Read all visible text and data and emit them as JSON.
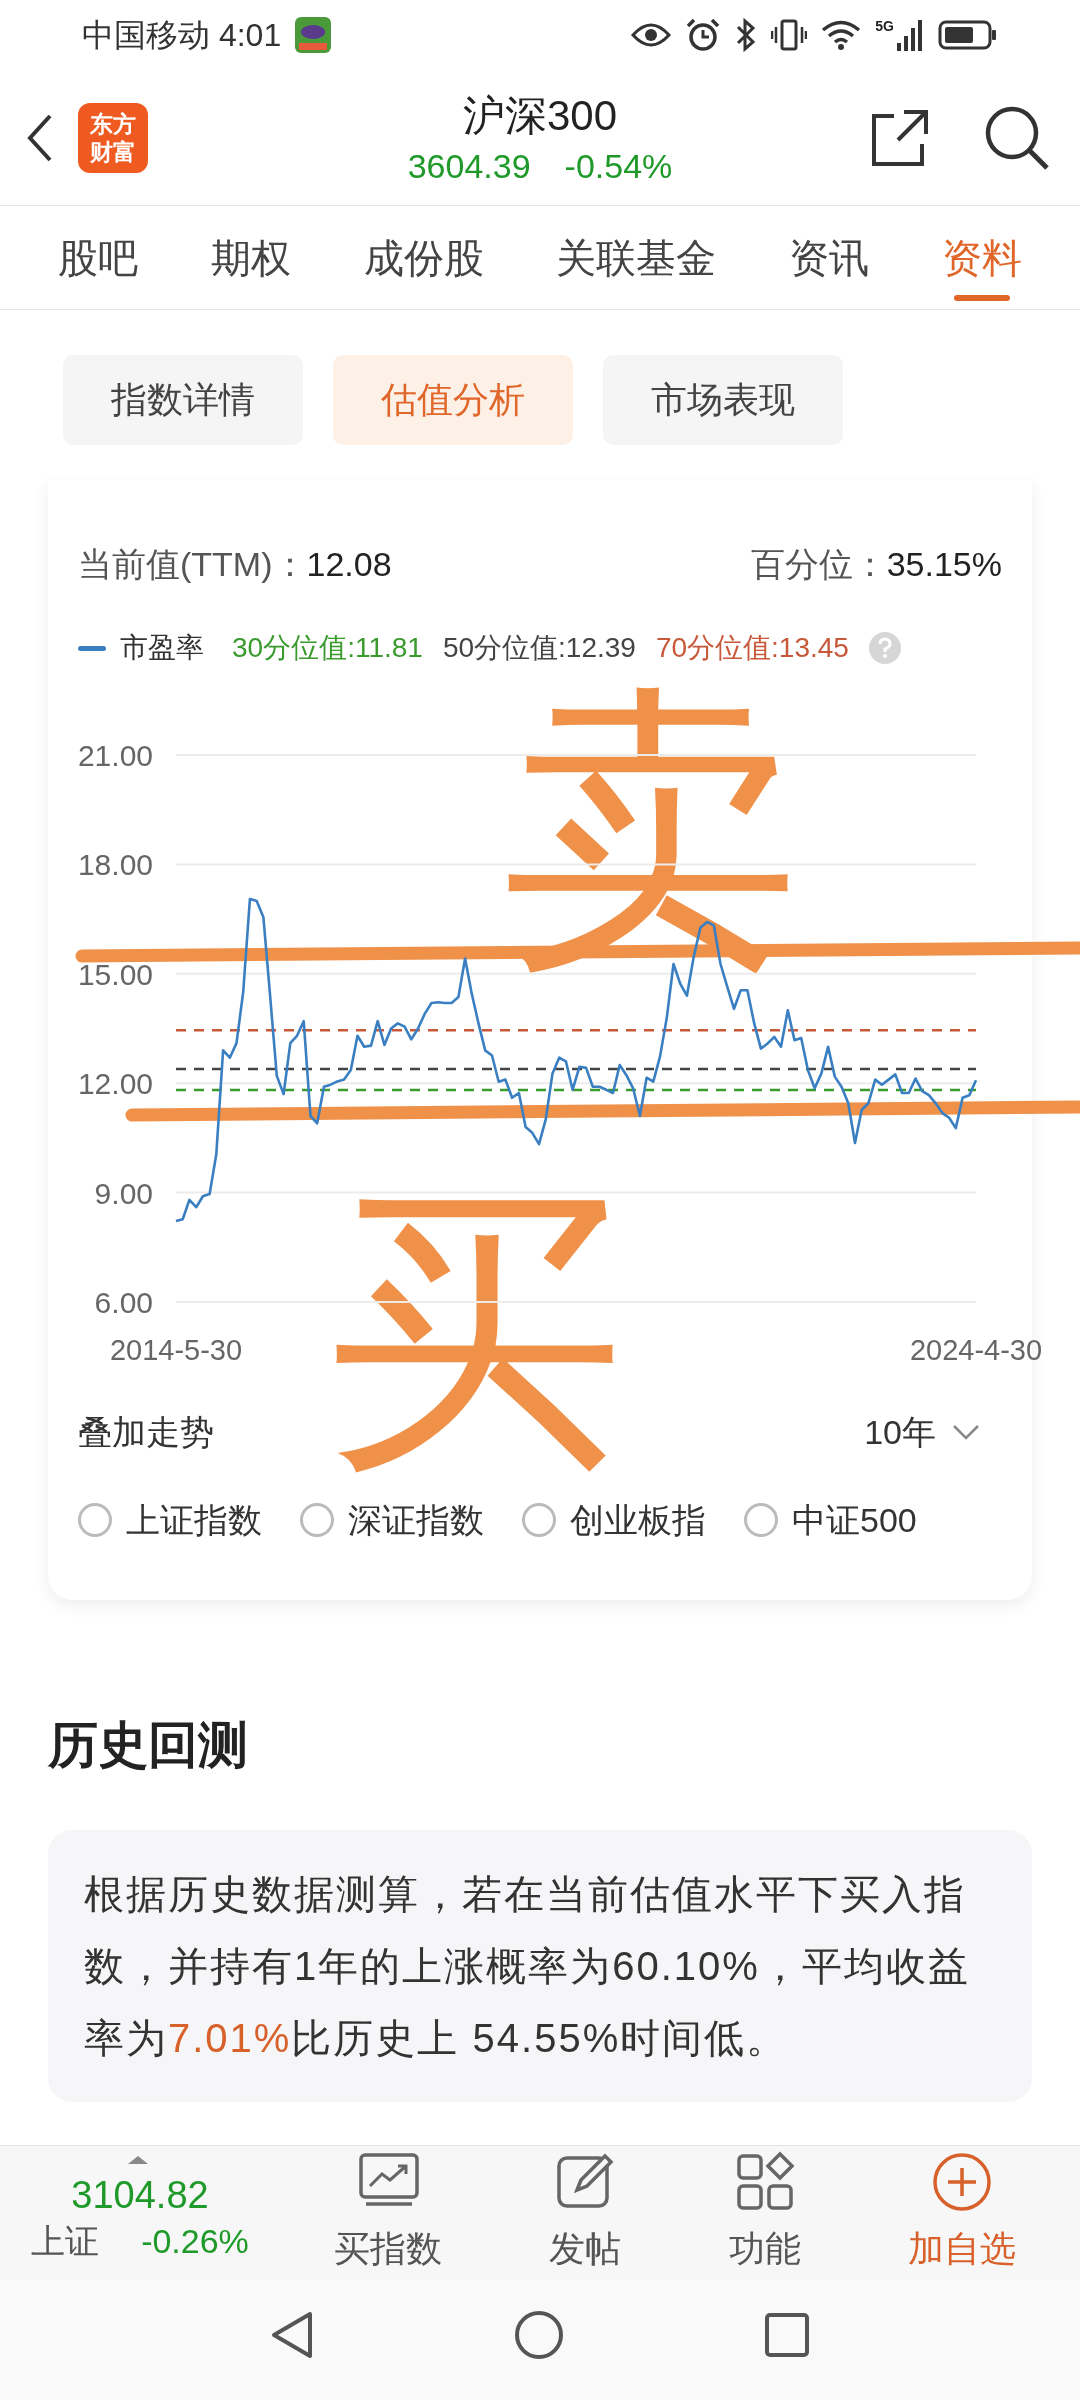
{
  "status_bar": {
    "carrier_time": "中国移动 4:01",
    "network": "5G"
  },
  "header": {
    "logo": [
      "东方",
      "财富"
    ],
    "title": "沪深300",
    "price": "3604.39",
    "change": "-0.54%"
  },
  "tabs": [
    {
      "label": "股吧",
      "selected": false
    },
    {
      "label": "期权",
      "selected": false
    },
    {
      "label": "成份股",
      "selected": false
    },
    {
      "label": "关联基金",
      "selected": false
    },
    {
      "label": "资讯",
      "selected": false
    },
    {
      "label": "资料",
      "selected": true
    }
  ],
  "sub_tabs": [
    {
      "label": "指数详情",
      "selected": false
    },
    {
      "label": "估值分析",
      "selected": true
    },
    {
      "label": "市场表现",
      "selected": false
    }
  ],
  "valuation": {
    "current_label": "当前值(TTM)：",
    "current_value": "12.08",
    "percentile_label": "百分位：",
    "percentile_value": "35.15%",
    "chart_data": {
      "type": "line",
      "ylim": [
        6,
        21
      ],
      "yticks": [
        {
          "value": 6,
          "label": "6.00"
        },
        {
          "value": 9,
          "label": "9.00"
        },
        {
          "value": 12,
          "label": "12.00"
        },
        {
          "value": 15,
          "label": "15.00"
        },
        {
          "value": 18,
          "label": "18.00"
        },
        {
          "value": 21,
          "label": "21.00"
        }
      ],
      "categories": [
        "2014-5-30",
        null,
        null,
        null,
        null,
        null,
        null,
        null,
        null,
        null,
        null,
        null,
        null,
        null,
        null,
        null,
        null,
        null,
        null,
        null,
        null,
        null,
        null,
        null,
        null,
        null,
        null,
        null,
        null,
        null,
        null,
        null,
        null,
        null,
        null,
        null,
        null,
        null,
        null,
        null,
        null,
        null,
        null,
        null,
        null,
        null,
        null,
        null,
        null,
        null,
        null,
        null,
        null,
        null,
        null,
        null,
        null,
        null,
        null,
        null,
        null,
        null,
        null,
        null,
        null,
        null,
        null,
        null,
        null,
        null,
        null,
        null,
        null,
        null,
        null,
        null,
        null,
        null,
        null,
        null,
        null,
        null,
        null,
        null,
        null,
        null,
        null,
        null,
        null,
        null,
        null,
        null,
        null,
        null,
        null,
        null,
        null,
        null,
        null,
        null,
        null,
        null,
        null,
        null,
        null,
        null,
        null,
        null,
        null,
        null,
        null,
        null,
        null,
        null,
        null,
        null,
        null,
        null,
        null,
        "2024-4-30"
      ],
      "series": [
        {
          "name": "市盈率",
          "color": "#3a7fc1",
          "line_style": "solid",
          "values": [
            8.22,
            8.27,
            8.8,
            8.6,
            8.9,
            8.96,
            10.05,
            12.9,
            12.7,
            13.1,
            14.5,
            17.05,
            17.0,
            16.55,
            14.4,
            12.2,
            11.7,
            13.1,
            13.3,
            13.7,
            11.1,
            10.9,
            11.9,
            11.96,
            12.05,
            12.1,
            12.36,
            13.3,
            13.0,
            13.03,
            13.7,
            13.05,
            13.5,
            13.64,
            13.55,
            13.2,
            13.5,
            13.9,
            14.2,
            14.22,
            14.2,
            14.2,
            14.36,
            15.42,
            14.45,
            13.64,
            12.9,
            12.76,
            12.04,
            12.1,
            11.6,
            11.73,
            10.8,
            10.64,
            10.33,
            11.0,
            12.27,
            12.7,
            12.6,
            11.82,
            12.45,
            12.42,
            11.9,
            11.9,
            11.82,
            11.73,
            12.5,
            12.22,
            11.86,
            11.1,
            12.15,
            12.04,
            12.73,
            13.8,
            15.27,
            14.73,
            14.4,
            15.45,
            16.27,
            16.42,
            16.33,
            15.27,
            14.64,
            14.04,
            14.55,
            14.55,
            13.64,
            12.95,
            13.09,
            13.27,
            13.0,
            14.0,
            13.18,
            13.24,
            12.36,
            11.86,
            12.27,
            13.0,
            12.18,
            11.9,
            11.45,
            10.36,
            11.27,
            11.45,
            12.1,
            11.96,
            12.1,
            12.24,
            11.73,
            11.73,
            12.13,
            11.78,
            11.67,
            11.45,
            11.18,
            11.05,
            10.77,
            11.6,
            11.67,
            12.08
          ]
        },
        {
          "name": "30分位值:11.81",
          "color": "#3a9a2e",
          "line_style": "dashed",
          "values": [
            11.81,
            11.81,
            11.81,
            11.81,
            11.81,
            11.81,
            11.81,
            11.81,
            11.81,
            11.81,
            11.81,
            11.81,
            11.81,
            11.81,
            11.81,
            11.81,
            11.81,
            11.81,
            11.81,
            11.81,
            11.81,
            11.81,
            11.81,
            11.81,
            11.81,
            11.81,
            11.81,
            11.81,
            11.81,
            11.81,
            11.81,
            11.81,
            11.81,
            11.81,
            11.81,
            11.81,
            11.81,
            11.81,
            11.81,
            11.81,
            11.81,
            11.81,
            11.81,
            11.81,
            11.81,
            11.81,
            11.81,
            11.81,
            11.81,
            11.81,
            11.81,
            11.81,
            11.81,
            11.81,
            11.81,
            11.81,
            11.81,
            11.81,
            11.81,
            11.81,
            11.81,
            11.81,
            11.81,
            11.81,
            11.81,
            11.81,
            11.81,
            11.81,
            11.81,
            11.81,
            11.81,
            11.81,
            11.81,
            11.81,
            11.81,
            11.81,
            11.81,
            11.81,
            11.81,
            11.81,
            11.81,
            11.81,
            11.81,
            11.81,
            11.81,
            11.81,
            11.81,
            11.81,
            11.81,
            11.81,
            11.81,
            11.81,
            11.81,
            11.81,
            11.81,
            11.81,
            11.81,
            11.81,
            11.81,
            11.81,
            11.81,
            11.81,
            11.81,
            11.81,
            11.81,
            11.81,
            11.81,
            11.81,
            11.81,
            11.81,
            11.81,
            11.81,
            11.81,
            11.81,
            11.81,
            11.81,
            11.81,
            11.81,
            11.81,
            11.81
          ]
        },
        {
          "name": "50分位值:12.39",
          "color": "#444444",
          "line_style": "dashed",
          "values": [
            12.39,
            12.39,
            12.39,
            12.39,
            12.39,
            12.39,
            12.39,
            12.39,
            12.39,
            12.39,
            12.39,
            12.39,
            12.39,
            12.39,
            12.39,
            12.39,
            12.39,
            12.39,
            12.39,
            12.39,
            12.39,
            12.39,
            12.39,
            12.39,
            12.39,
            12.39,
            12.39,
            12.39,
            12.39,
            12.39,
            12.39,
            12.39,
            12.39,
            12.39,
            12.39,
            12.39,
            12.39,
            12.39,
            12.39,
            12.39,
            12.39,
            12.39,
            12.39,
            12.39,
            12.39,
            12.39,
            12.39,
            12.39,
            12.39,
            12.39,
            12.39,
            12.39,
            12.39,
            12.39,
            12.39,
            12.39,
            12.39,
            12.39,
            12.39,
            12.39,
            12.39,
            12.39,
            12.39,
            12.39,
            12.39,
            12.39,
            12.39,
            12.39,
            12.39,
            12.39,
            12.39,
            12.39,
            12.39,
            12.39,
            12.39,
            12.39,
            12.39,
            12.39,
            12.39,
            12.39,
            12.39,
            12.39,
            12.39,
            12.39,
            12.39,
            12.39,
            12.39,
            12.39,
            12.39,
            12.39,
            12.39,
            12.39,
            12.39,
            12.39,
            12.39,
            12.39,
            12.39,
            12.39,
            12.39,
            12.39,
            12.39,
            12.39,
            12.39,
            12.39,
            12.39,
            12.39,
            12.39,
            12.39,
            12.39,
            12.39,
            12.39,
            12.39,
            12.39,
            12.39,
            12.39,
            12.39,
            12.39,
            12.39,
            12.39,
            12.39
          ]
        },
        {
          "name": "70分位值:13.45",
          "color": "#c8583a",
          "line_style": "dashed",
          "values": [
            13.45,
            13.45,
            13.45,
            13.45,
            13.45,
            13.45,
            13.45,
            13.45,
            13.45,
            13.45,
            13.45,
            13.45,
            13.45,
            13.45,
            13.45,
            13.45,
            13.45,
            13.45,
            13.45,
            13.45,
            13.45,
            13.45,
            13.45,
            13.45,
            13.45,
            13.45,
            13.45,
            13.45,
            13.45,
            13.45,
            13.45,
            13.45,
            13.45,
            13.45,
            13.45,
            13.45,
            13.45,
            13.45,
            13.45,
            13.45,
            13.45,
            13.45,
            13.45,
            13.45,
            13.45,
            13.45,
            13.45,
            13.45,
            13.45,
            13.45,
            13.45,
            13.45,
            13.45,
            13.45,
            13.45,
            13.45,
            13.45,
            13.45,
            13.45,
            13.45,
            13.45,
            13.45,
            13.45,
            13.45,
            13.45,
            13.45,
            13.45,
            13.45,
            13.45,
            13.45,
            13.45,
            13.45,
            13.45,
            13.45,
            13.45,
            13.45,
            13.45,
            13.45,
            13.45,
            13.45,
            13.45,
            13.45,
            13.45,
            13.45,
            13.45,
            13.45,
            13.45,
            13.45,
            13.45,
            13.45,
            13.45,
            13.45,
            13.45,
            13.45,
            13.45,
            13.45,
            13.45,
            13.45,
            13.45,
            13.45,
            13.45,
            13.45,
            13.45,
            13.45,
            13.45,
            13.45,
            13.45,
            13.45,
            13.45,
            13.45,
            13.45,
            13.45,
            13.45,
            13.45,
            13.45,
            13.45,
            13.45,
            13.45,
            13.45,
            13.45
          ]
        }
      ],
      "grid": true
    },
    "overlay_label": "叠加走势",
    "range": "10年",
    "overlays": [
      {
        "label": "上证指数",
        "checked": false
      },
      {
        "label": "深证指数",
        "checked": false
      },
      {
        "label": "创业板指",
        "checked": false
      },
      {
        "label": "中证500",
        "checked": false
      }
    ]
  },
  "handwriting": [
    {
      "text": "卖"
    },
    {
      "text": "买"
    }
  ],
  "backtest": {
    "title": "历史回测",
    "text": "根据历史数据测算，若在当前估值水平下买入指数，并持有1年的上涨概率为60.10%，平均收益率为**7.01%**比历史上 54.55%时间低。"
  },
  "bottom_bar": {
    "index_price": "3104.82",
    "index_name": "上证",
    "index_change": "-0.26%",
    "actions": [
      {
        "kind": "chart",
        "label": "买指数",
        "selected": false
      },
      {
        "kind": "post",
        "label": "发帖",
        "selected": false
      },
      {
        "kind": "grid",
        "label": "功能",
        "selected": false
      },
      {
        "kind": "add",
        "label": "加自选",
        "selected": true
      }
    ]
  }
}
